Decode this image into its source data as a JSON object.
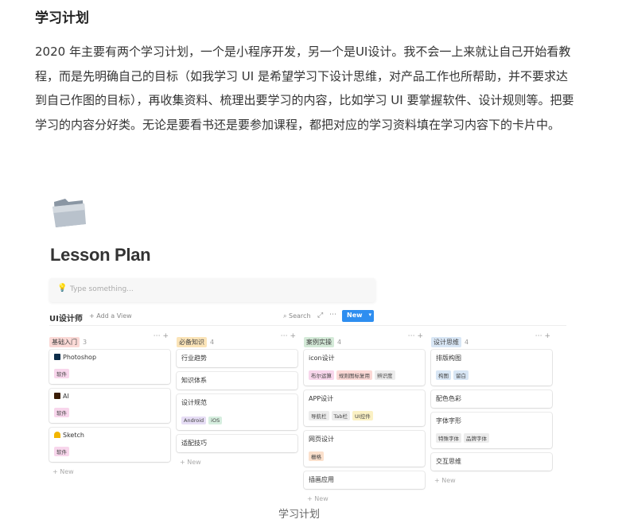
{
  "article": {
    "heading": "学习计划",
    "paragraph": "2020 年主要有两个学习计划，一个是小程序开发，另一个是UI设计。我不会一上来就让自己开始看教程，而是先明确自己的目标（如我学习 UI 是希望学习下设计思维，对产品工作也所帮助，并不要求达到自己作图的目标），再收集资料、梳理出要学习的内容，比如学习 UI 要掌握软件、设计规则等。把要学习的内容分好类。无论是要看书还是要参加课程，都把对应的学习资料填在学习内容下的卡片中。",
    "caption": "学习计划"
  },
  "notion": {
    "page_title": "Lesson Plan",
    "placeholder": "Type something...",
    "toolbar": {
      "view_name": "UI设计师",
      "add_view": "+ Add a View",
      "search": "Search",
      "new_button": "New"
    },
    "columns": [
      {
        "name": "基础入门",
        "count": "3",
        "color": "#fbd9d6",
        "cards": [
          {
            "title": "Photoshop",
            "icon": "ps",
            "tags": [
              {
                "label": "软件",
                "color": "#f8d6ec"
              }
            ]
          },
          {
            "title": "AI",
            "icon": "ai",
            "tags": [
              {
                "label": "软件",
                "color": "#f8d6ec"
              }
            ]
          },
          {
            "title": "Sketch",
            "icon": "sketch",
            "tags": [
              {
                "label": "软件",
                "color": "#f8d6ec"
              }
            ]
          }
        ],
        "add_new": "+ New"
      },
      {
        "name": "必备知识",
        "count": "4",
        "color": "#fbe4b8",
        "cards": [
          {
            "title": "行业趋势",
            "tags": []
          },
          {
            "title": "知识体系",
            "tags": []
          },
          {
            "title": "设计规范",
            "tags": [
              {
                "label": "Android",
                "color": "#e6ddf5"
              },
              {
                "label": "iOS",
                "color": "#d6eedf"
              }
            ]
          },
          {
            "title": "适配技巧",
            "tags": []
          }
        ],
        "add_new": "+ New"
      },
      {
        "name": "案例实操",
        "count": "4",
        "color": "#d4ead8",
        "cards": [
          {
            "title": "icon设计",
            "tags": [
              {
                "label": "布尔运算",
                "color": "#f8d6ec"
              },
              {
                "label": "规则图标复用",
                "color": "#fbd9d6"
              },
              {
                "label": "辨识度",
                "color": "#ececec"
              }
            ]
          },
          {
            "title": "APP设计",
            "tags": [
              {
                "label": "导航栏",
                "color": "#ececec"
              },
              {
                "label": "Tab栏",
                "color": "#ececec"
              },
              {
                "label": "UI控件",
                "color": "#fbf1c4"
              }
            ]
          },
          {
            "title": "网页设计",
            "tags": [
              {
                "label": "栅格",
                "color": "#fbe0cc"
              }
            ]
          },
          {
            "title": "插画应用",
            "tags": []
          }
        ],
        "add_new": "+ New"
      },
      {
        "name": "设计思维",
        "count": "4",
        "color": "#d8e6f5",
        "cards": [
          {
            "title": "排版构图",
            "tags": [
              {
                "label": "构图",
                "color": "#d8e6f5"
              },
              {
                "label": "留白",
                "color": "#d8e6f5"
              }
            ]
          },
          {
            "title": "配色色彩",
            "tags": []
          },
          {
            "title": "字体字形",
            "tags": [
              {
                "label": "特殊字体",
                "color": "#ececec"
              },
              {
                "label": "品牌字体",
                "color": "#ececec"
              }
            ]
          },
          {
            "title": "交互思维",
            "tags": []
          }
        ],
        "add_new": "+ New"
      }
    ]
  }
}
